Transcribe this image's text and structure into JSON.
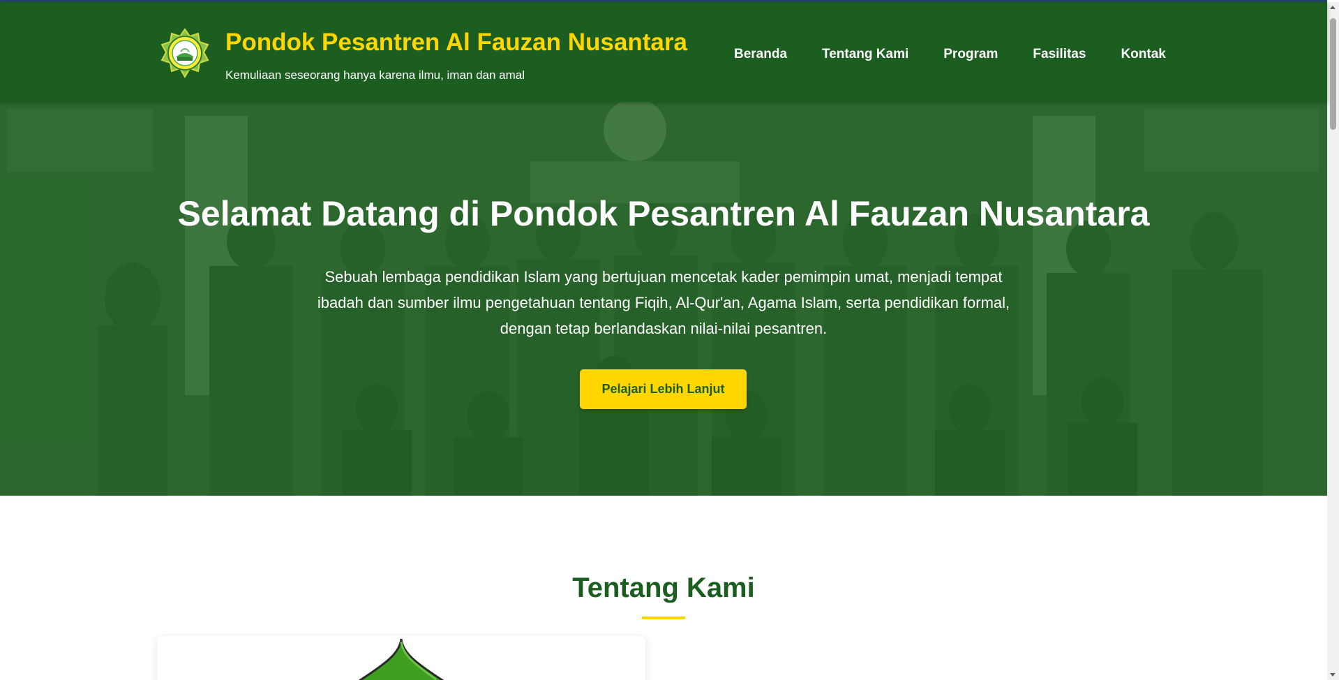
{
  "header": {
    "title": "Pondok Pesantren Al Fauzan Nusantara",
    "tagline": "Kemuliaan seseorang hanya karena ilmu, iman dan amal",
    "logo_icon": "pesantren-logo-emblem"
  },
  "nav": {
    "items": [
      {
        "label": "Beranda"
      },
      {
        "label": "Tentang Kami"
      },
      {
        "label": "Program"
      },
      {
        "label": "Fasilitas"
      },
      {
        "label": "Kontak"
      }
    ]
  },
  "hero": {
    "title": "Selamat Datang di Pondok Pesantren Al Fauzan Nusantara",
    "description": "Sebuah lembaga pendidikan Islam yang bertujuan mencetak kader pemimpin umat, menjadi tempat ibadah dan sumber ilmu pengetahuan tentang Fiqih, Al-Qur'an, Agama Islam, serta pendidikan formal, dengan tetap berlandaskan nilai-nilai pesantren.",
    "button_label": "Pelajari Lebih Lanjut",
    "background_icon": "group-photo-background"
  },
  "about": {
    "title": "Tentang Kami",
    "ornament_icon": "dome-ornament-icon"
  },
  "colors": {
    "primary_green": "#1b5e20",
    "accent_yellow": "#ffd600",
    "white": "#ffffff"
  }
}
